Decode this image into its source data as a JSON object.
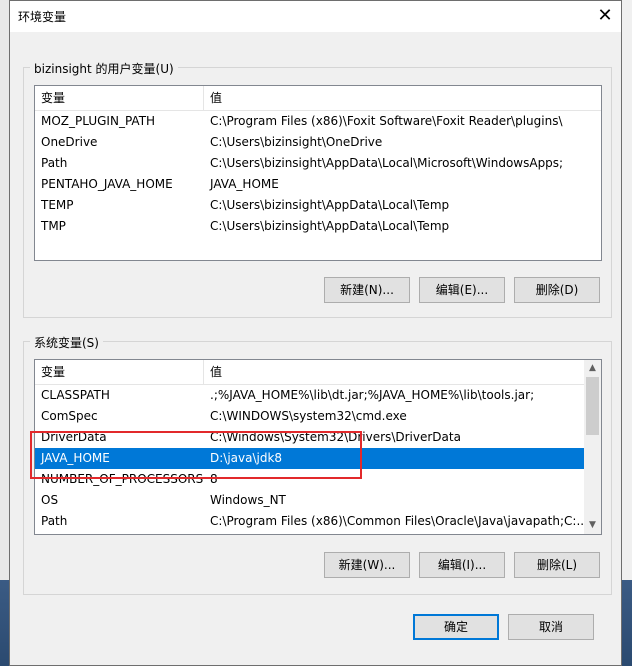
{
  "window": {
    "title": "环境变量",
    "close_glyph": "✕"
  },
  "user_vars": {
    "legend": "bizinsight 的用户变量(U)",
    "col_name": "变量",
    "col_value": "值",
    "rows": [
      {
        "name": "MOZ_PLUGIN_PATH",
        "value": "C:\\Program Files (x86)\\Foxit Software\\Foxit Reader\\plugins\\"
      },
      {
        "name": "OneDrive",
        "value": "C:\\Users\\bizinsight\\OneDrive"
      },
      {
        "name": "Path",
        "value": "C:\\Users\\bizinsight\\AppData\\Local\\Microsoft\\WindowsApps;"
      },
      {
        "name": "PENTAHO_JAVA_HOME",
        "value": "JAVA_HOME"
      },
      {
        "name": "TEMP",
        "value": "C:\\Users\\bizinsight\\AppData\\Local\\Temp"
      },
      {
        "name": "TMP",
        "value": "C:\\Users\\bizinsight\\AppData\\Local\\Temp"
      }
    ],
    "buttons": {
      "new": "新建(N)...",
      "edit": "编辑(E)...",
      "delete": "删除(D)"
    }
  },
  "system_vars": {
    "legend": "系统变量(S)",
    "col_name": "变量",
    "col_value": "值",
    "selected_name": "JAVA_HOME",
    "rows": [
      {
        "name": "CLASSPATH",
        "value": ".;%JAVA_HOME%\\lib\\dt.jar;%JAVA_HOME%\\lib\\tools.jar;"
      },
      {
        "name": "ComSpec",
        "value": "C:\\WINDOWS\\system32\\cmd.exe"
      },
      {
        "name": "DriverData",
        "value": "C:\\Windows\\System32\\Drivers\\DriverData"
      },
      {
        "name": "JAVA_HOME",
        "value": "D:\\java\\jdk8"
      },
      {
        "name": "NUMBER_OF_PROCESSORS",
        "value": "8"
      },
      {
        "name": "OS",
        "value": "Windows_NT"
      },
      {
        "name": "Path",
        "value": "C:\\Program Files (x86)\\Common Files\\Oracle\\Java\\javapath;C:..."
      }
    ],
    "scroll_up_glyph": "▲",
    "scroll_down_glyph": "▼",
    "buttons": {
      "new": "新建(W)...",
      "edit": "编辑(I)...",
      "delete": "删除(L)"
    }
  },
  "footer": {
    "ok": "确定",
    "cancel": "取消"
  },
  "colors": {
    "selection": "#0078d7",
    "highlight_box": "#e2292b",
    "desktop": "#3d5e86"
  }
}
